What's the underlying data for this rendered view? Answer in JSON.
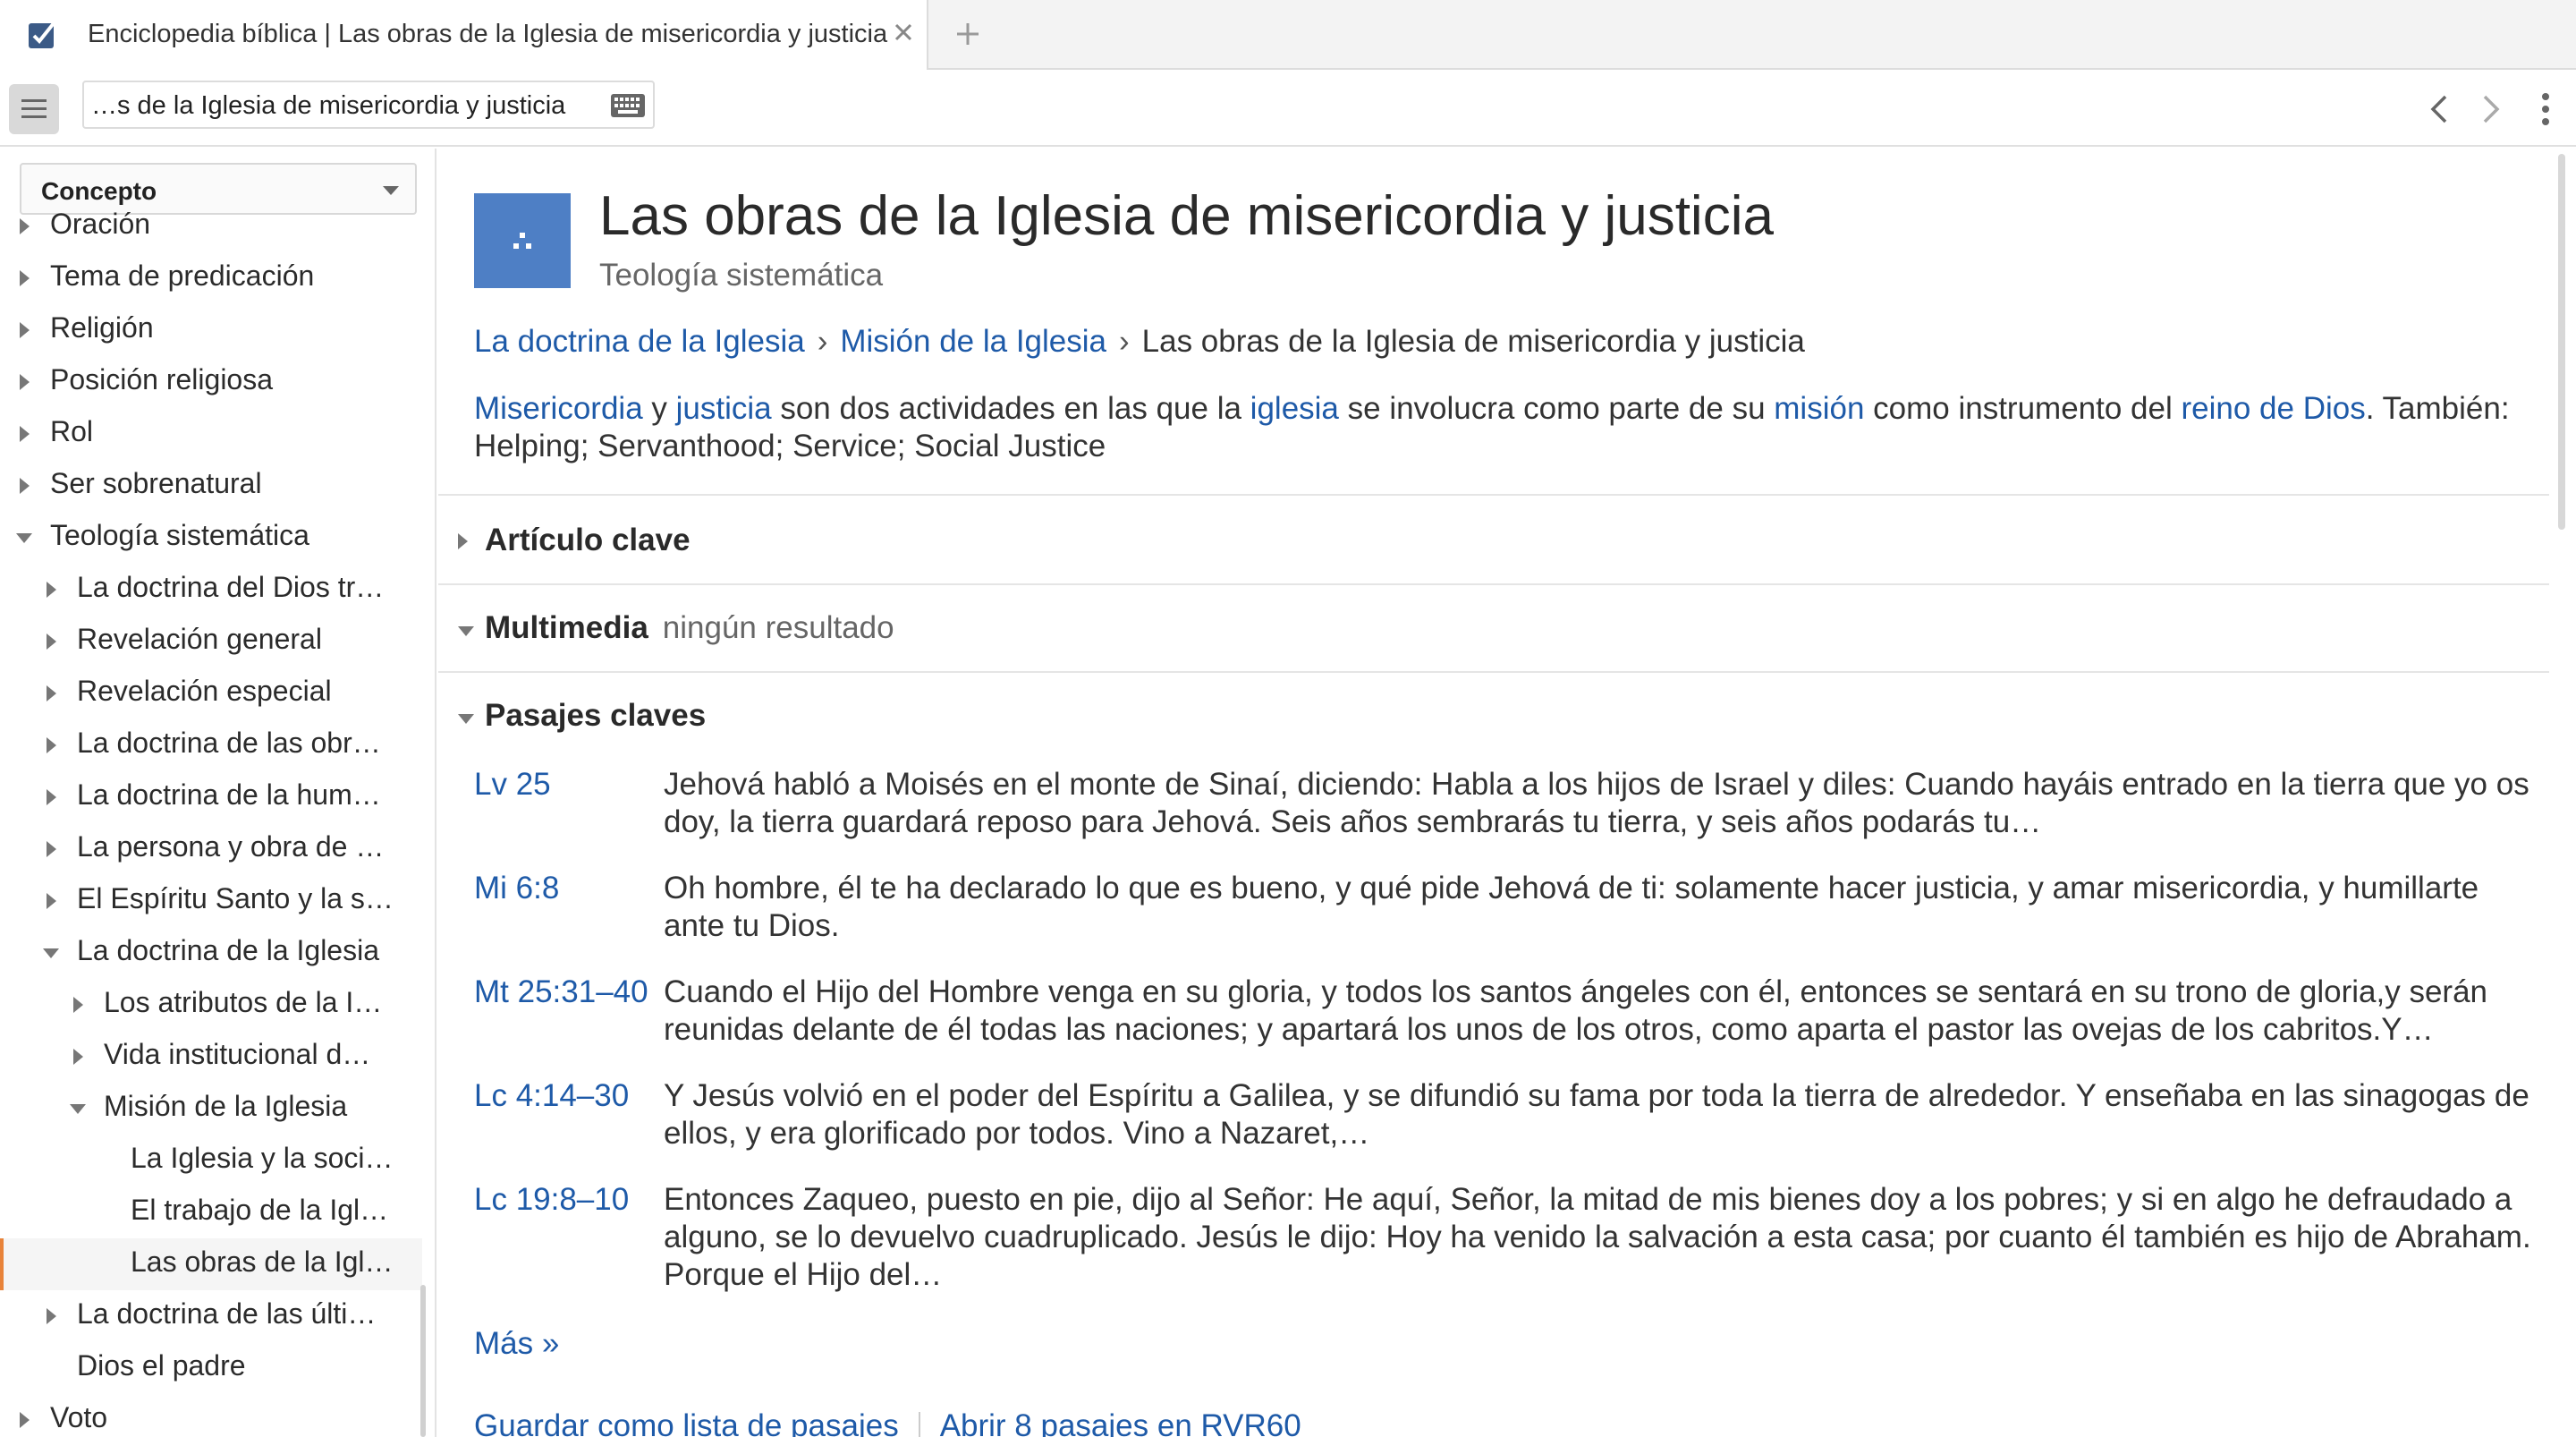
{
  "tab": {
    "title": "Enciclopedia bíblica | Las obras de la Iglesia de misericordia y justicia"
  },
  "toolbar": {
    "address": "…s de la Iglesia de misericordia y justicia"
  },
  "sidebar": {
    "select_label": "Concepto",
    "items": [
      {
        "label": "Oración",
        "level": 0,
        "state": "collapsed"
      },
      {
        "label": "Tema de predicación",
        "level": 0,
        "state": "collapsed"
      },
      {
        "label": "Religión",
        "level": 0,
        "state": "collapsed"
      },
      {
        "label": "Posición religiosa",
        "level": 0,
        "state": "collapsed"
      },
      {
        "label": "Rol",
        "level": 0,
        "state": "collapsed"
      },
      {
        "label": "Ser sobrenatural",
        "level": 0,
        "state": "collapsed"
      },
      {
        "label": "Teología sistemática",
        "level": 0,
        "state": "expanded"
      },
      {
        "label": "La doctrina del Dios tr…",
        "level": 1,
        "state": "collapsed"
      },
      {
        "label": "Revelación general",
        "level": 1,
        "state": "collapsed"
      },
      {
        "label": "Revelación especial",
        "level": 1,
        "state": "collapsed"
      },
      {
        "label": "La doctrina de las obr…",
        "level": 1,
        "state": "collapsed"
      },
      {
        "label": "La doctrina de la hum…",
        "level": 1,
        "state": "collapsed"
      },
      {
        "label": "La persona y obra de …",
        "level": 1,
        "state": "collapsed"
      },
      {
        "label": "El Espíritu Santo y la s…",
        "level": 1,
        "state": "collapsed"
      },
      {
        "label": "La doctrina de la Iglesia",
        "level": 1,
        "state": "expanded"
      },
      {
        "label": "Los atributos de la I…",
        "level": 2,
        "state": "collapsed"
      },
      {
        "label": "Vida institucional d…",
        "level": 2,
        "state": "collapsed"
      },
      {
        "label": "Misión de la Iglesia",
        "level": 2,
        "state": "expanded"
      },
      {
        "label": "La Iglesia y la soci…",
        "level": 3,
        "state": "leaf"
      },
      {
        "label": "El trabajo de la Igl…",
        "level": 3,
        "state": "leaf"
      },
      {
        "label": "Las obras de la Igl…",
        "level": 3,
        "state": "leaf",
        "selected": true
      },
      {
        "label": "La doctrina de las últi…",
        "level": 1,
        "state": "collapsed"
      },
      {
        "label": "Dios el padre",
        "level": 1,
        "state": "leaf"
      },
      {
        "label": "Voto",
        "level": 0,
        "state": "collapsed"
      }
    ]
  },
  "main": {
    "title": "Las obras de la Iglesia de misericordia y justicia",
    "subtitle": "Teología sistemática",
    "breadcrumb": {
      "link1": "La doctrina de la Iglesia",
      "link2": "Misión de la Iglesia",
      "separator": "›",
      "current": "Las obras de la Iglesia de misericordia y justicia"
    },
    "description": {
      "l1": "Misericordia",
      "t1": " y ",
      "l2": "justicia",
      "t2": " son dos actividades en las que la ",
      "l3": "iglesia",
      "t3": " se involucra como parte de su ",
      "l4": "misión",
      "t4": " como instrumento del ",
      "l5": "reino de Dios",
      "t5": ". También: Helping; Servanthood; Service; Social Justice"
    },
    "sections": {
      "key_article": "Artículo clave",
      "multimedia": "Multimedia",
      "multimedia_status": "ningún resultado",
      "key_passages": "Pasajes claves"
    },
    "passages": [
      {
        "ref": "Lv 25",
        "text": "Jehová habló a Moisés en el monte de Sinaí, diciendo: Habla a los hijos de Israel y diles: Cuando hayáis entrado en la tierra que yo os doy, la tierra guardará reposo para Jehová. Seis años sembrarás tu tierra, y seis años podarás tu…"
      },
      {
        "ref": "Mi 6:8",
        "text": "Oh hombre, él te ha declarado lo que es bueno, y qué pide Jehová de ti: solamente hacer justicia, y amar misericordia, y humillarte ante tu Dios."
      },
      {
        "ref": "Mt 25:31–40",
        "text": "Cuando el Hijo del Hombre venga en su gloria, y todos los santos ángeles con él, entonces se sentará en su trono de gloria,y serán reunidas delante de él todas las naciones; y apartará los unos de los otros, como aparta el pastor las ovejas de los cabritos.Y…"
      },
      {
        "ref": "Lc 4:14–30",
        "text": "Y Jesús volvió en el poder del Espíritu a Galilea, y se difundió su fama por toda la tierra de alrededor. Y enseñaba en las sinagogas de ellos, y era glorificado por todos. Vino a Nazaret,…"
      },
      {
        "ref": "Lc 19:8–10",
        "text": "Entonces Zaqueo, puesto en pie, dijo al Señor: He aquí, Señor, la mitad de mis bienes doy a los pobres; y si en algo he defraudado a alguno, se lo devuelvo cuadruplicado. Jesús le dijo: Hoy ha venido la salvación a esta casa; por cuanto él también es hijo de Abraham. Porque el Hijo del…"
      }
    ],
    "more_label": "Más »",
    "save_list_label": "Guardar como lista de pasajes",
    "open_passages_label": "Abrir 8 pasajes en RVR60"
  },
  "colors": {
    "link": "#1e5aa8",
    "hero_icon": "#4e7fc5",
    "selection_accent": "#e8833a"
  },
  "icons": {
    "tab": "checkbox-icon",
    "close": "close-icon",
    "add": "plus-icon",
    "menu": "hamburger-icon",
    "keyboard": "keyboard-icon",
    "back": "chevron-left-icon",
    "forward": "chevron-right-icon",
    "more": "kebab-icon"
  }
}
